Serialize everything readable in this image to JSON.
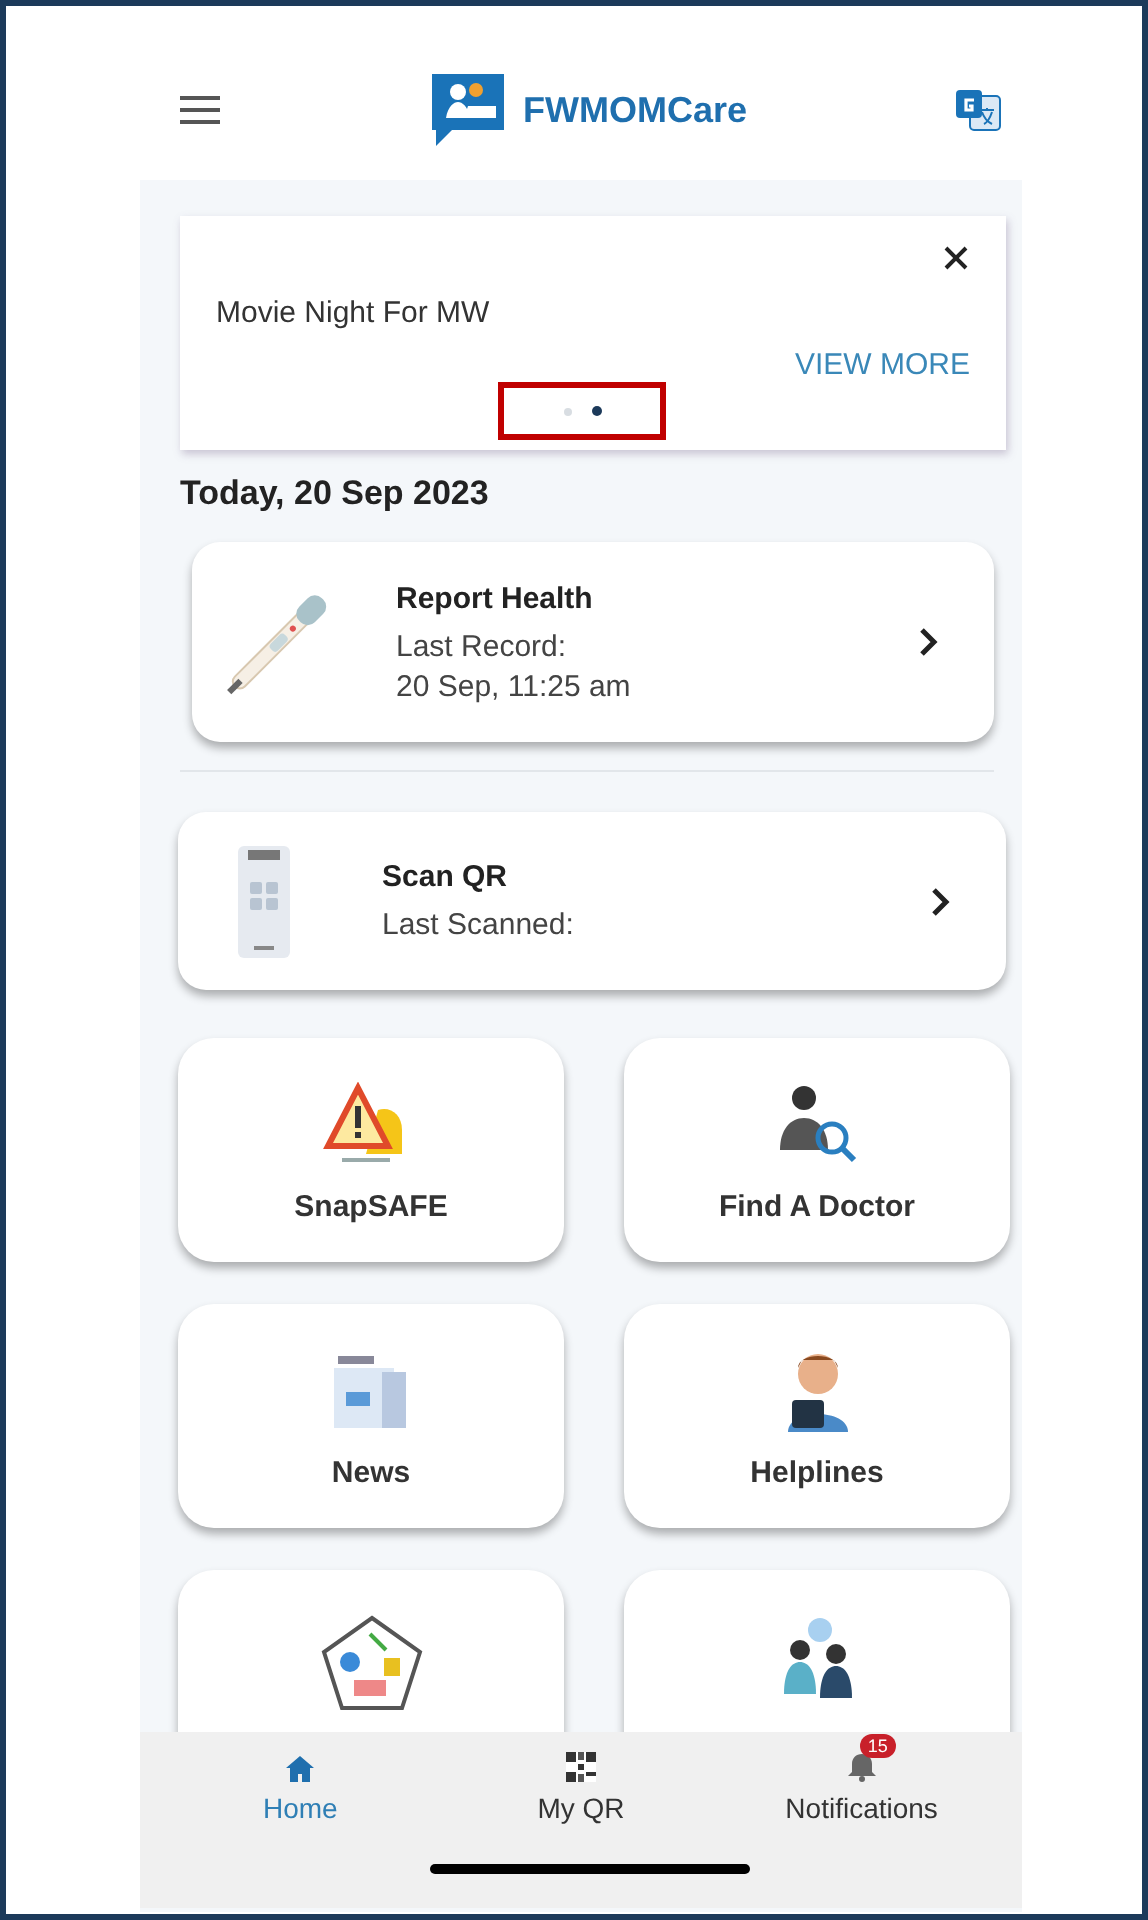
{
  "header": {
    "title": "FWMOMCare"
  },
  "banner": {
    "text": "Movie Night For MW",
    "action": "VIEW MORE",
    "dots": [
      {
        "selected": false
      },
      {
        "selected": true
      }
    ]
  },
  "date": "Today, 20 Sep 2023",
  "cards": [
    {
      "kind": "health",
      "title": "Report Health",
      "lines": [
        "Last Record:",
        "20 Sep, 11:25 am"
      ]
    },
    {
      "kind": "qr",
      "title": "Scan QR",
      "lines": [
        "Last Scanned:"
      ]
    }
  ],
  "tiles": [
    {
      "kind": "snapsafe",
      "label": "SnapSAFE"
    },
    {
      "kind": "doctor",
      "label": "Find A Doctor"
    },
    {
      "kind": "news",
      "label": "News"
    },
    {
      "kind": "helpline",
      "label": "Helplines"
    },
    {
      "kind": "pentagon"
    },
    {
      "kind": "talk"
    }
  ],
  "nav": [
    {
      "kind": "home",
      "label": "Home",
      "selected": true
    },
    {
      "kind": "qr",
      "label": "My QR",
      "selected": false
    },
    {
      "kind": "bell",
      "label": "Notifications",
      "selected": false,
      "badge": "15"
    }
  ]
}
